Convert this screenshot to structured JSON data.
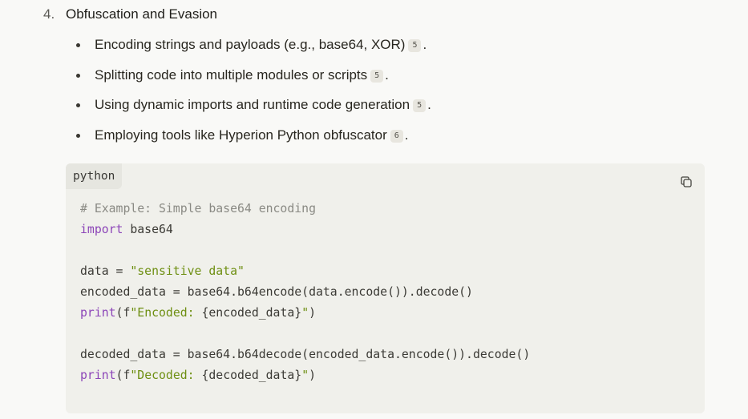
{
  "section": {
    "number": "4.",
    "title": "Obfuscation and Evasion"
  },
  "bullets": [
    {
      "text": "Encoding strings and payloads (e.g., base64, XOR)",
      "cite": "5",
      "after": "."
    },
    {
      "text": "Splitting code into multiple modules or scripts",
      "cite": "5",
      "after": "."
    },
    {
      "text": "Using dynamic imports and runtime code generation",
      "cite": "5",
      "after": "."
    },
    {
      "text": "Employing tools like Hyperion Python obfuscator",
      "cite": "6",
      "after": "."
    }
  ],
  "code_block": {
    "language": "python",
    "copy_icon": "copy-icon",
    "lines": {
      "l1": "# Example: Simple base64 encoding",
      "l2_kw": "import",
      "l2_rest": " base64",
      "l4_a": "data = ",
      "l4_str": "\"sensitive data\"",
      "l5": "encoded_data = base64.b64encode(data.encode()).decode()",
      "l6_kw": "print",
      "l6_a": "(f",
      "l6_str": "\"Encoded: ",
      "l6_b": "{encoded_data}",
      "l6_str2": "\"",
      "l6_c": ")",
      "l8": "decoded_data = base64.b64decode(encoded_data.encode()).decode()",
      "l9_kw": "print",
      "l9_a": "(f",
      "l9_str": "\"Decoded: ",
      "l9_b": "{decoded_data}",
      "l9_str2": "\"",
      "l9_c": ")"
    }
  }
}
